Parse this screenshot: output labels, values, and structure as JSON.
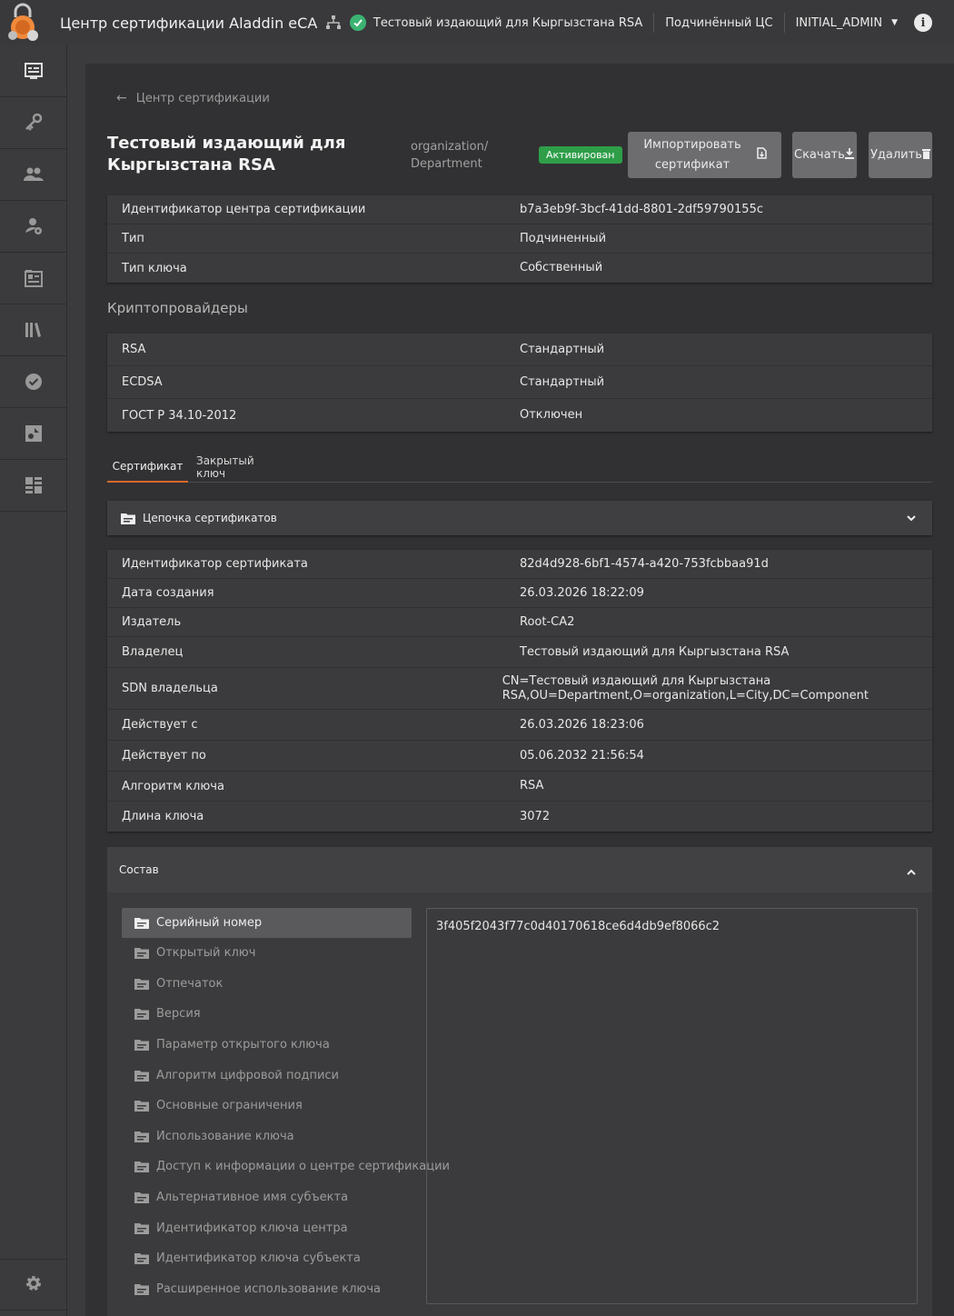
{
  "header": {
    "app_title": "Центр сертификации Aladdin eCA",
    "current_ca": "Тестовый издающий для Кыргызстана RSA",
    "ca_type": "Подчинённый ЦС",
    "user": "INITIAL_ADMIN",
    "info_label": "i",
    "icons": [
      "logo",
      "hierarchy-icon",
      "status-ok-icon",
      "caret-down-icon",
      "info-icon"
    ]
  },
  "sidebar": {
    "items": [
      "dashboard-icon",
      "keys-icon",
      "users-icon",
      "user-settings-icon",
      "certificate-folder-icon",
      "library-icon",
      "verified-icon",
      "template-icon",
      "grid-icon"
    ],
    "bottom": "settings-icon"
  },
  "breadcrumb": {
    "label": "Центр сертификации"
  },
  "ca": {
    "title": "Тестовый издающий для Кыргызстана RSA",
    "org_line1": "organization/",
    "org_line2": "Department",
    "status": "Активирован",
    "status_color": "#2e9e48"
  },
  "actions": {
    "import_label": "Импортировать сертификат",
    "download_label": "Скачать",
    "delete_label": "Удалить"
  },
  "ca_info": [
    {
      "key": "Идентификатор центра сертификации",
      "value": "b7a3eb9f-3bcf-41dd-8801-2df59790155c"
    },
    {
      "key": "Тип",
      "value": "Подчиненный"
    },
    {
      "key": "Тип ключа",
      "value": "Собственный"
    }
  ],
  "providers": {
    "title": "Криптопровайдеры",
    "rows": [
      {
        "key": "RSA",
        "value": "Стандартный"
      },
      {
        "key": "ECDSA",
        "value": "Стандартный"
      },
      {
        "key": "ГОСТ Р 34.10-2012",
        "value": "Отключен"
      }
    ]
  },
  "tabs": [
    {
      "label": "Сертификат",
      "active": true
    },
    {
      "label": "Закрытый ключ",
      "active": false
    }
  ],
  "chain": {
    "label": "Цепочка сертификатов"
  },
  "cert_info": [
    {
      "key": "Идентификатор сертификата",
      "value": "82d4d928-6bf1-4574-a420-753fcbbaa91d"
    },
    {
      "key": "Дата создания",
      "value": "26.03.2026 18:22:09"
    },
    {
      "key": "Издатель",
      "value": "Root-CA2"
    },
    {
      "key": "Владелец",
      "value": "Тестовый издающий для Кыргызстана RSA"
    },
    {
      "key": "SDN владельца",
      "value": "CN=Тестовый издающий для Кыргызстана RSA,OU=Department,O=organization,L=City,DC=Component"
    },
    {
      "key": "Действует с",
      "value": "26.03.2026 18:23:06"
    },
    {
      "key": "Действует по",
      "value": "05.06.2032 21:56:54"
    },
    {
      "key": "Алгоритм ключа",
      "value": "RSA"
    },
    {
      "key": "Длина ключа",
      "value": "3072"
    }
  ],
  "composition": {
    "title": "Состав",
    "items": [
      "Серийный номер",
      "Открытый ключ",
      "Отпечаток",
      "Версия",
      "Параметр открытого ключа",
      "Алгоритм цифровой подписи",
      "Основные ограничения",
      "Использование ключа",
      "Доступ к информации о центре сертификации",
      "Альтернативное имя субъекта",
      "Идентификатор ключа центра",
      "Идентификатор ключа субъекта",
      "Расширенное использование ключа"
    ],
    "selected_index": 0,
    "selected_value": "3f405f2043f77c0d40170618ce6d4db9ef8066c2"
  },
  "colors": {
    "accent": "#d9682f",
    "background": "#3b3b3d",
    "panel": "#313133",
    "button": "#6d6d70"
  }
}
